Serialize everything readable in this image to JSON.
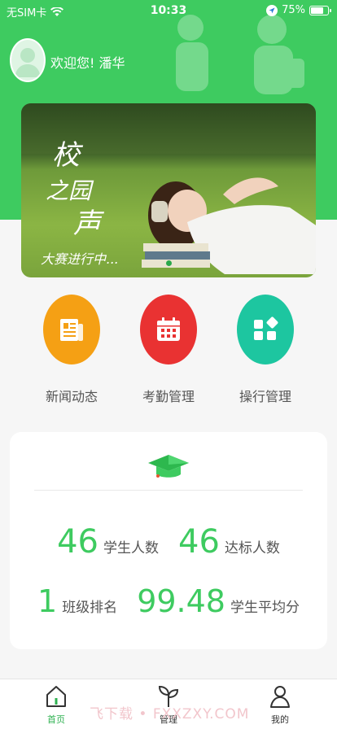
{
  "status_bar": {
    "carrier": "无SIM卡",
    "time": "10:33",
    "battery": "75%",
    "battery_level": 0.75
  },
  "header": {
    "greeting": "欢迎您! 潘华"
  },
  "banner": {
    "title_line1": "校",
    "title_line2": "之园",
    "title_line3": "声",
    "subtitle": "大赛进行中...",
    "slide_count": 1,
    "active_slide": 0
  },
  "quick_actions": [
    {
      "label": "新闻动态",
      "icon": "newspaper-icon",
      "color": "#f5a014"
    },
    {
      "label": "考勤管理",
      "icon": "calendar-icon",
      "color": "#e93232"
    },
    {
      "label": "操行管理",
      "icon": "apps-icon",
      "color": "#1dc6a0"
    }
  ],
  "stats": {
    "icon": "graduation-cap-icon",
    "student_count": "46",
    "student_count_label": "学生人数",
    "qualified_count": "46",
    "qualified_count_label": "达标人数",
    "class_rank": "1",
    "class_rank_label": "班级排名",
    "average_score": "99.48",
    "average_score_label": "学生平均分"
  },
  "tab_bar": {
    "tabs": [
      {
        "label": "首页",
        "icon": "home-icon",
        "active": true
      },
      {
        "label": "管理",
        "icon": "sprout-icon",
        "active": false
      },
      {
        "label": "我的",
        "icon": "user-icon",
        "active": false
      }
    ],
    "watermark": "飞下载 • FXXZXY.COM"
  },
  "colors": {
    "primary": "#3ecb60",
    "active_tab": "#2eb150"
  }
}
